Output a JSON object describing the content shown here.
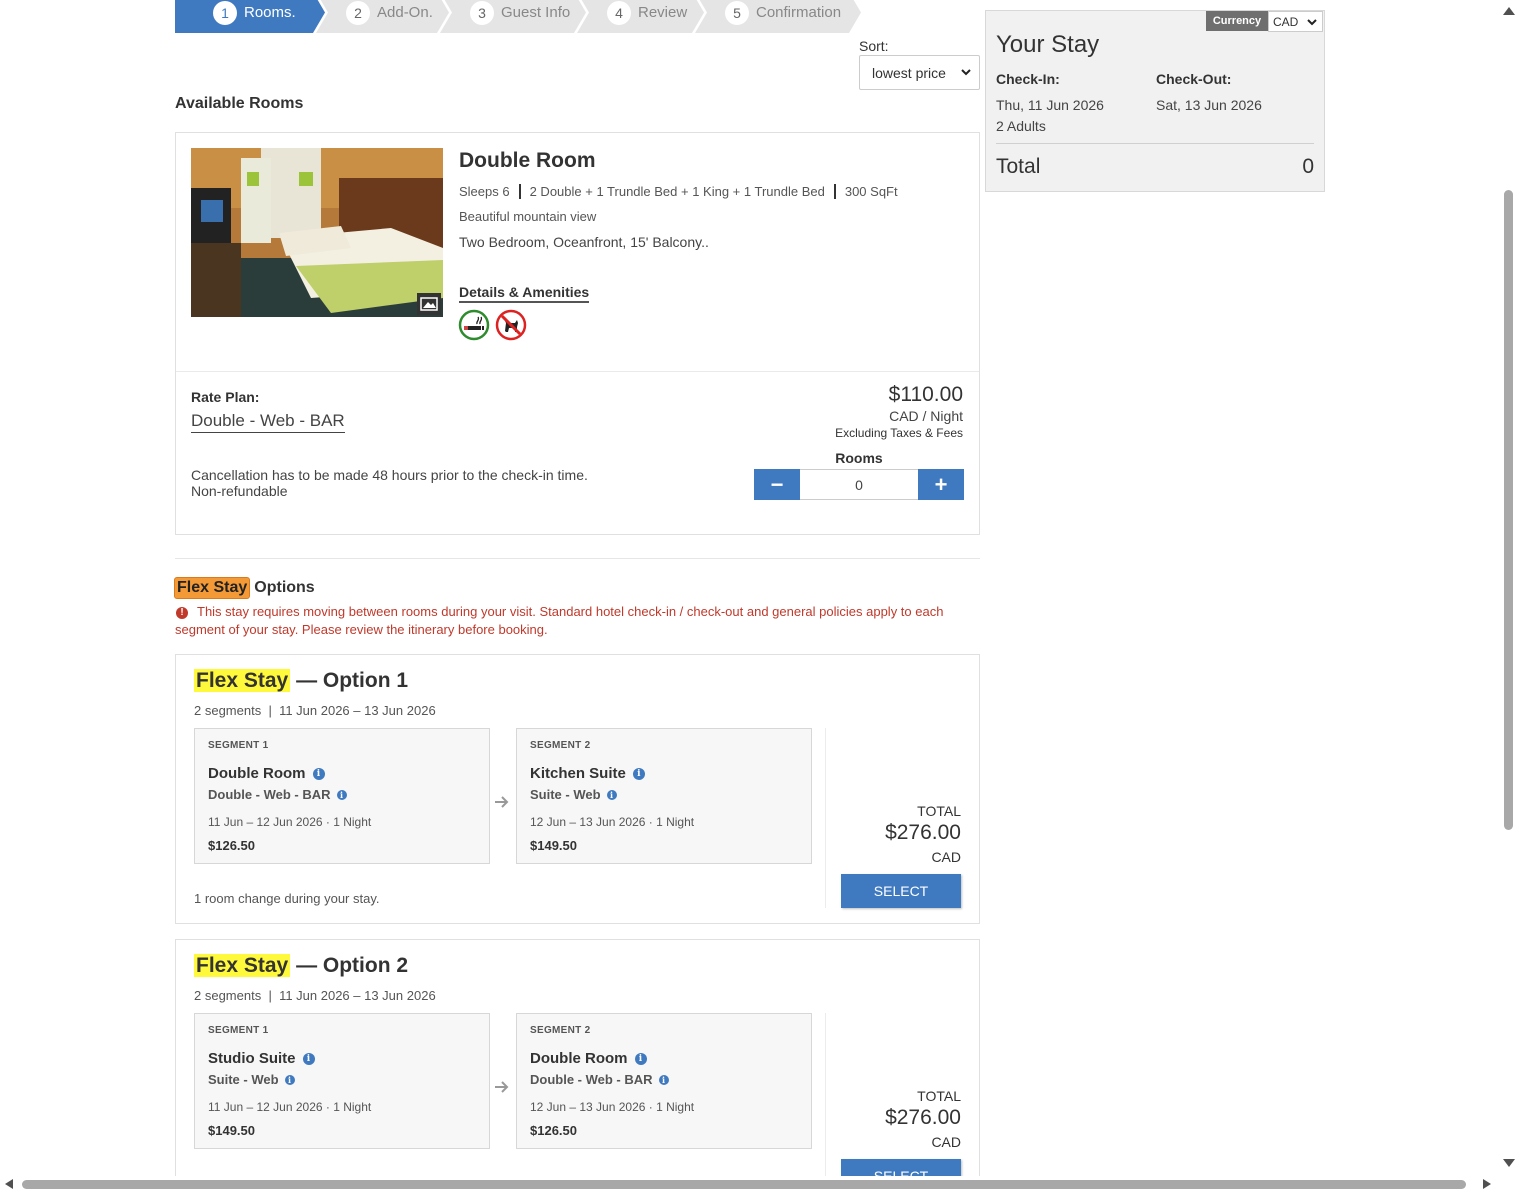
{
  "steps": [
    {
      "num": "1",
      "label": "Rooms.",
      "active": true
    },
    {
      "num": "2",
      "label": "Add-On."
    },
    {
      "num": "3",
      "label": "Guest Info"
    },
    {
      "num": "4",
      "label": "Review"
    },
    {
      "num": "5",
      "label": "Confirmation"
    }
  ],
  "sort": {
    "label": "Sort:",
    "value": "lowest price"
  },
  "available_title": "Available Rooms",
  "room": {
    "name": "Double Room",
    "sleeps": "Sleeps 6",
    "beds": "2 Double + 1 Trundle Bed + 1 King + 1 Trundle Bed",
    "size": "300 SqFt",
    "view": "Beautiful mountain view",
    "description": "Two Bedroom, Oceanfront, 15' Balcony..",
    "details_link": "Details & Amenities",
    "amenity_icons": [
      "smoking-allowed-icon",
      "no-pets-icon"
    ],
    "rate_plan_label": "Rate Plan:",
    "rate_plan_name": "Double - Web - BAR",
    "price": "$110.00",
    "price_unit": "CAD / Night",
    "price_note": "Excluding Taxes & Fees",
    "cancellation": "Cancellation has to be made 48 hours prior to the check-in time.",
    "refund": "Non-refundable",
    "rooms_label": "Rooms",
    "rooms_count": "0",
    "minus": "−",
    "plus": "+"
  },
  "flex": {
    "tag": "Flex Stay",
    "heading_suffix": "Options",
    "warning": "This stay requires moving between rooms during your visit. Standard hotel check-in / check-out and general policies apply to each segment of your stay. Please review the itinerary before booking.",
    "options": [
      {
        "tag": "Flex Stay",
        "title_suffix": "— Option 1",
        "segments_count": "2 segments",
        "date_range": "11 Jun 2026 – 13 Jun 2026",
        "segments": [
          {
            "label": "SEGMENT 1",
            "room": "Double Room",
            "rate": "Double - Web - BAR",
            "dates": "11 Jun – 12 Jun 2026 · 1 Night",
            "price": "$126.50"
          },
          {
            "label": "SEGMENT 2",
            "room": "Kitchen Suite",
            "rate": "Suite - Web",
            "dates": "12 Jun – 13 Jun 2026 · 1 Night",
            "price": "$149.50"
          }
        ],
        "note": "1 room change during your stay.",
        "total_label": "TOTAL",
        "total": "$276.00",
        "currency": "CAD",
        "select_label": "SELECT"
      },
      {
        "tag": "Flex Stay",
        "title_suffix": "— Option 2",
        "segments_count": "2 segments",
        "date_range": "11 Jun 2026 – 13 Jun 2026",
        "segments": [
          {
            "label": "SEGMENT 1",
            "room": "Studio Suite",
            "rate": "Suite - Web",
            "dates": "11 Jun – 12 Jun 2026 · 1 Night",
            "price": "$149.50"
          },
          {
            "label": "SEGMENT 2",
            "room": "Double Room",
            "rate": "Double - Web - BAR",
            "dates": "12 Jun – 13 Jun 2026 · 1 Night",
            "price": "$126.50"
          }
        ],
        "total_label": "TOTAL",
        "total": "$276.00",
        "currency": "CAD",
        "select_label": "SELECT"
      }
    ]
  },
  "stay": {
    "currency_label": "Currency",
    "currency_value": "CAD",
    "title": "Your Stay",
    "checkin_label": "Check-In:",
    "checkout_label": "Check-Out:",
    "checkin": "Thu, 11 Jun 2026",
    "checkout": "Sat, 13 Jun 2026",
    "guests": "2 Adults",
    "total_label": "Total",
    "total_value": "0"
  },
  "colors": {
    "accent": "#3f7ac0",
    "flex_tag": "#f39a37",
    "highlight": "#fff93b",
    "warning": "#c0392b"
  }
}
